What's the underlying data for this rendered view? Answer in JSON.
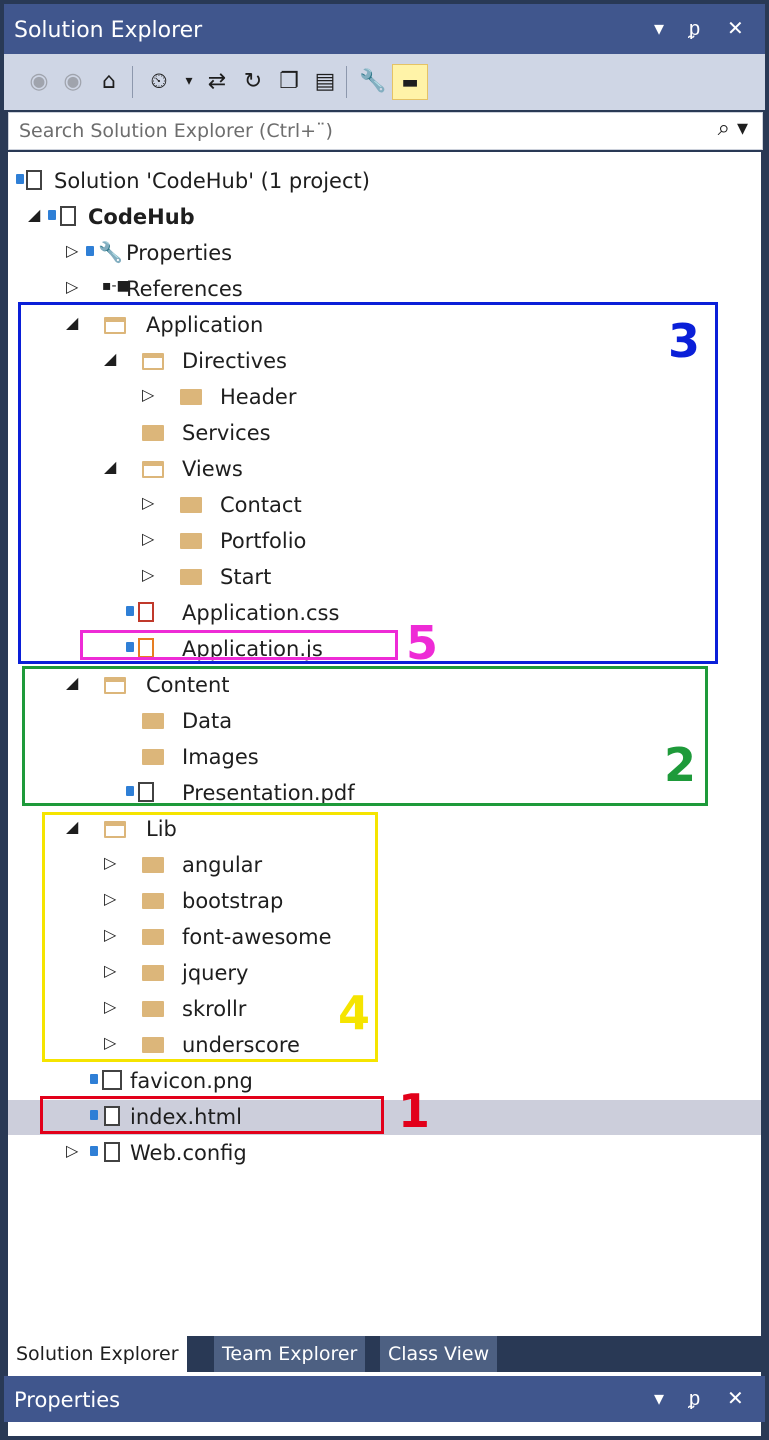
{
  "window": {
    "title": "Solution Explorer",
    "controls": [
      "▾",
      "ᵱ",
      "✕"
    ]
  },
  "toolbar": {
    "icons": [
      "back-icon",
      "forward-icon",
      "home-icon",
      "pending-changes-icon",
      "sync-icon",
      "refresh-icon",
      "collapse-all-icon",
      "show-all-files-icon",
      "properties-icon",
      "preview-icon"
    ]
  },
  "search": {
    "placeholder": "Search Solution Explorer (Ctrl+¨)"
  },
  "tree": [
    {
      "label": "Solution 'CodeHub' (1 project)",
      "bold": false
    },
    {
      "label": "CodeHub",
      "bold": true
    },
    {
      "label": "Properties"
    },
    {
      "label": "References"
    },
    {
      "label": "Application"
    },
    {
      "label": "Directives"
    },
    {
      "label": "Header"
    },
    {
      "label": "Services"
    },
    {
      "label": "Views"
    },
    {
      "label": "Contact"
    },
    {
      "label": "Portfolio"
    },
    {
      "label": "Start"
    },
    {
      "label": "Application.css"
    },
    {
      "label": "Application.js"
    },
    {
      "label": "Content"
    },
    {
      "label": "Data"
    },
    {
      "label": "Images"
    },
    {
      "label": "Presentation.pdf"
    },
    {
      "label": "Lib"
    },
    {
      "label": "angular"
    },
    {
      "label": "bootstrap"
    },
    {
      "label": "font-awesome"
    },
    {
      "label": "jquery"
    },
    {
      "label": "skrollr"
    },
    {
      "label": "underscore"
    },
    {
      "label": "favicon.png"
    },
    {
      "label": "index.html"
    },
    {
      "label": "Web.config"
    }
  ],
  "annotations": {
    "n1": "1",
    "n2": "2",
    "n3": "3",
    "n4": "4",
    "n5": "5",
    "colors": {
      "n1": "#e2001a",
      "n2": "#1e9a3a",
      "n3": "#0a1fd8",
      "n4": "#f5e400",
      "n5": "#ee2bd6"
    }
  },
  "bottom_tabs": [
    "Solution Explorer",
    "Team Explorer",
    "Class View"
  ],
  "properties_panel": {
    "title": "Properties"
  }
}
